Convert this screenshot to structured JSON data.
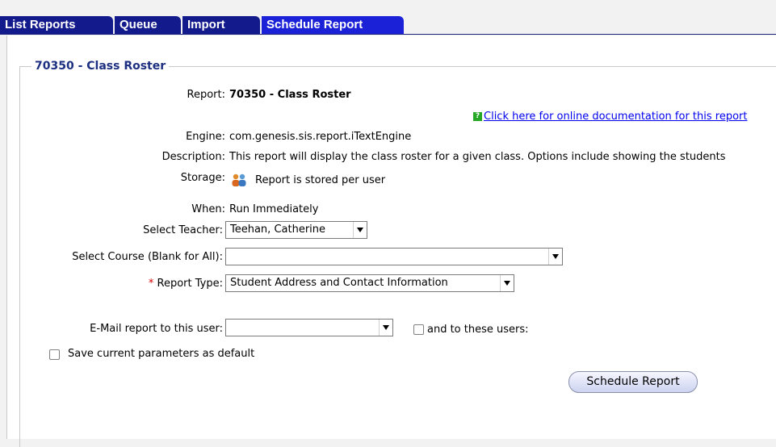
{
  "tabs": [
    {
      "label": "List Reports"
    },
    {
      "label": "Queue"
    },
    {
      "label": "Import"
    },
    {
      "label": "Schedule Report"
    }
  ],
  "section": {
    "title": "70350 -  Class Roster"
  },
  "fields": {
    "report_label": "Report:",
    "report_value": "70350 -  Class Roster",
    "doc_link": "Click here for online documentation for this report",
    "engine_label": "Engine:",
    "engine_value": "com.genesis.sis.report.iTextEngine",
    "description_label": "Description:",
    "description_value": "This report will display the class roster for a given class. Options include showing the students",
    "storage_label": "Storage:",
    "storage_value": "Report is stored per user",
    "when_label": "When:",
    "when_value": "Run Immediately",
    "teacher_label": "Select Teacher:",
    "teacher_value": "Teehan, Catherine",
    "course_label": "Select Course (Blank for All):",
    "course_value": "",
    "report_type_required": "*",
    "report_type_label": "Report Type:",
    "report_type_value": "Student Address and Contact Information",
    "email_label": "E-Mail report to this user:",
    "email_value": "",
    "and_users_label": "and to these users:",
    "save_default_label": "Save current parameters as default"
  },
  "buttons": {
    "schedule": "Schedule Report"
  },
  "icons": {
    "help": "help-icon",
    "users": "users-icon"
  },
  "colors": {
    "tab": "#131a8c",
    "tab_active": "#1b21d6",
    "section_title": "#1c2f80",
    "link": "#0000ee",
    "required": "#d40000"
  }
}
